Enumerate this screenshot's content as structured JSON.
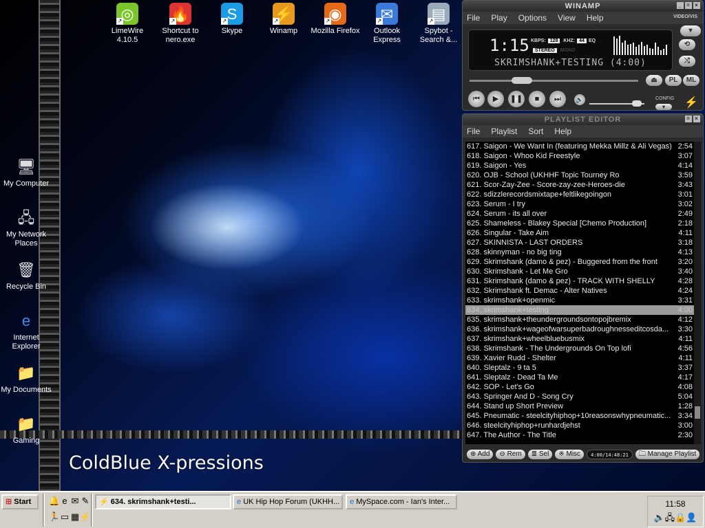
{
  "desktop": {
    "top_icons": [
      {
        "label": "LimeWire 4.10.5",
        "icon": "limewire-icon",
        "color": "#7bc42a",
        "glyph": "◎"
      },
      {
        "label": "Shortcut to nero.exe",
        "icon": "nero-icon",
        "color": "#d33",
        "glyph": "🔥"
      },
      {
        "label": "Skype",
        "icon": "skype-icon",
        "color": "#1a9be6",
        "glyph": "S"
      },
      {
        "label": "Winamp",
        "icon": "winamp-icon",
        "color": "#e89a20",
        "glyph": "⚡"
      },
      {
        "label": "Mozilla Firefox",
        "icon": "firefox-icon",
        "color": "#e46a18",
        "glyph": "◉"
      },
      {
        "label": "Outlook Express",
        "icon": "outlook-express-icon",
        "color": "#3a7ad8",
        "glyph": "✉"
      },
      {
        "label": "Spybot - Search &...",
        "icon": "spybot-icon",
        "color": "#9ab",
        "glyph": "▤"
      }
    ],
    "left_icons": [
      {
        "label": "My Computer",
        "icon": "my-computer-icon",
        "glyph": "🖥"
      },
      {
        "label": "My Network Places",
        "icon": "network-places-icon",
        "glyph": "🖧"
      },
      {
        "label": "Recycle Bin",
        "icon": "recycle-bin-icon",
        "glyph": "🗑"
      },
      {
        "label": "Internet Explorer",
        "icon": "internet-explorer-icon",
        "glyph": "e"
      },
      {
        "label": "My Documents",
        "icon": "my-documents-icon",
        "glyph": "📁"
      },
      {
        "label": "Gaming",
        "icon": "folder-icon",
        "glyph": "📁"
      }
    ],
    "wallpaper_logo": "ColdBlue X-pressions"
  },
  "winamp": {
    "title": "WINAMP",
    "menu": [
      "File",
      "Play",
      "Options",
      "View",
      "Help"
    ],
    "time": "1:15",
    "kbps_label": "KBPS:",
    "kbps": "128",
    "khz_label": "KHZ:",
    "khz": "44",
    "eq": "EQ",
    "stereo": "STEREO",
    "mono": "MONO",
    "song": "SKRIMSHANK+TESTING (4:00)",
    "video_vis": "VIDEO/VIS",
    "config": "CONFIG",
    "pl": "PL",
    "ml": "ML",
    "seek_fraction": 0.31,
    "volume_fraction": 0.9,
    "vis_levels": [
      0.9,
      0.8,
      0.95,
      0.6,
      0.7,
      0.5,
      0.55,
      0.6,
      0.4,
      0.5,
      0.65,
      0.45,
      0.5,
      0.35,
      0.3,
      0.6,
      0.4,
      0.25,
      0.3,
      0.5
    ]
  },
  "playlist": {
    "title": "PLAYLIST EDITOR",
    "menu": [
      "File",
      "Playlist",
      "Sort",
      "Help"
    ],
    "selected_index": 17,
    "tracks": [
      [
        "617. Saigon - We Want In (featuring Mekka Millz & Ali Vegas)",
        "2:54"
      ],
      [
        "618. Saigon - Whoo Kid Freestyle",
        "3:07"
      ],
      [
        "619. Saigon - Yes",
        "4:14"
      ],
      [
        "620. OJB - School (UKHHF Topic Tourney Ro",
        "3:59"
      ],
      [
        "621. Scor-Zay-Zee - Score-zay-zee-Heroes-die",
        "3:43"
      ],
      [
        "622. sdizzlerecordsmixtape+feltlikegoingon",
        "3:01"
      ],
      [
        "623. Serum - I try",
        "3:02"
      ],
      [
        "624. Serum - its all over",
        "2:49"
      ],
      [
        "625. Shameless - Blakey Special [Chemo Production]",
        "2:18"
      ],
      [
        "626. Singular - Take Aim",
        "4:11"
      ],
      [
        "627. SKINNISTA - LAST ORDERS",
        "3:18"
      ],
      [
        "628. skinnyman - no big ting",
        "4:13"
      ],
      [
        "629. Skrimshank (damo & pez) - Buggered from the front",
        "3:20"
      ],
      [
        "630. Skrimshank - Let Me Gro",
        "3:40"
      ],
      [
        "631. Skrimshank (damo & pez) - TRACK WITH SHELLY",
        "4:28"
      ],
      [
        "632. Skrimshank ft. Demac - Alter Natives",
        "4:24"
      ],
      [
        "633. skrimshank+openmic",
        "3:31"
      ],
      [
        "634. skrimshank+testing",
        "4:00"
      ],
      [
        "635. skrimshank+theundergroundsontopojbremix",
        "4:12"
      ],
      [
        "636. skrimshank+wageofwarsuperbadroughnesseditcosda...",
        "3:30"
      ],
      [
        "637. skrimshank+wheelbluebusmix",
        "4:11"
      ],
      [
        "638. Skrimshank - The Undergrounds On Top  lofi",
        "4:56"
      ],
      [
        "639. Xavier Rudd - Shelter",
        "4:11"
      ],
      [
        "640. Sleptalz - 9 ta 5",
        "3:37"
      ],
      [
        "641. Sleptalz - Dead Ta Me",
        "4:17"
      ],
      [
        "642. SOP - Let's Go",
        "4:08"
      ],
      [
        "643. Springer And D - Song Cry",
        "5:04"
      ],
      [
        "644. Stand up Short Preview",
        "1:28"
      ],
      [
        "645. Pneumatic - steelcityhiphop+10reasonswhypneumatic...",
        "3:34"
      ],
      [
        "646. steelcityhiphop+runhardjehst",
        "3:00"
      ],
      [
        "647. The Author - The Title",
        "2:30"
      ]
    ],
    "buttons": {
      "add": "Add",
      "rem": "Rem",
      "sel": "Sel",
      "misc": "Misc",
      "manage": "Manage Playlist"
    },
    "total_time": "4:00/14:48:21"
  },
  "taskbar": {
    "start": "Start",
    "quick_launch": [
      "aim-icon",
      "internet-explorer-icon",
      "outlook-express-icon",
      "notepad-icon",
      "counter-strike-icon",
      "drive-icon",
      "chip-icon",
      "winamp-icon"
    ],
    "tasks": [
      "634. skrimshank+testi...",
      "UK Hip Hop Forum (UKHH...",
      "MySpace.com - Ian's Inter..."
    ],
    "clock": "11:58"
  }
}
